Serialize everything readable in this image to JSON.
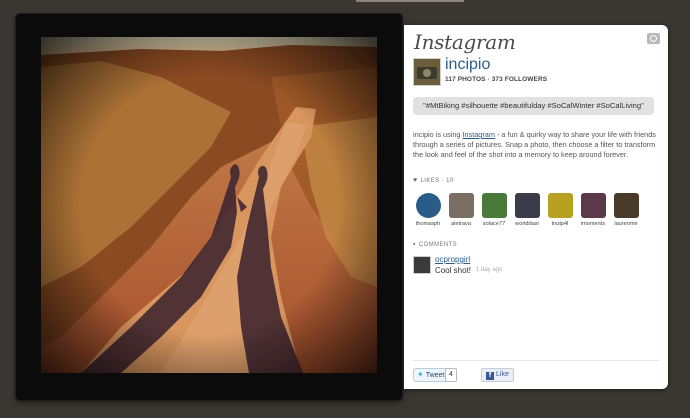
{
  "app": {
    "logo": "Instagram"
  },
  "profile": {
    "username": "incipio",
    "stats": "117 PHOTOS · 373 FOLLOWERS"
  },
  "post": {
    "hashtags": "\"#MtBiking #silhouette #beautifulday #SoCalWinter #SoCalLiving\"",
    "description_pre": "incipio is using ",
    "description_link": "Instagram",
    "description_post": " - a fun & quirky way to share your life with friends through a series of pictures. Snap a photo, then choose a filter to transform the look and feel of the shot into a memory to keep around forever."
  },
  "likes": {
    "label": "LIKES",
    "count": "10",
    "users": [
      {
        "name": "thomasph",
        "color": "#2a5c8a"
      },
      {
        "name": "aletrava",
        "color": "#7a6f62"
      },
      {
        "name": "solace77",
        "color": "#4a7a3a"
      },
      {
        "name": "worlddasi",
        "color": "#3a3a4a"
      },
      {
        "name": "tnutp4l",
        "color": "#b8a020"
      },
      {
        "name": "imoments",
        "color": "#5a3a4a"
      },
      {
        "name": "laurenme",
        "color": "#4a3a2a"
      }
    ]
  },
  "comments": {
    "label": "COMMENTS",
    "items": [
      {
        "user": "ocpropgirl",
        "text": "Cool shot!",
        "time": "1 day ago"
      }
    ]
  },
  "share": {
    "tweet_label": "Tweet",
    "tweet_count": "4",
    "like_label": "Like"
  },
  "icons": {
    "camera": "camera-icon",
    "heart": "heart-icon",
    "comment": "comment-icon",
    "twitter": "twitter-bird-icon",
    "facebook": "facebook-icon"
  }
}
